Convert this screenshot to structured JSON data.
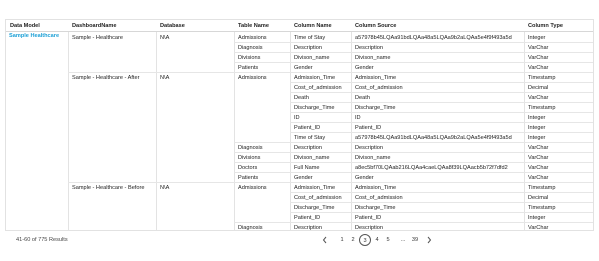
{
  "headers": [
    "Data Model",
    "DashboardName",
    "Database",
    "Table Name",
    "Column Name",
    "Column Source",
    "Column Type"
  ],
  "data_model": "Sample Healthcare",
  "groups": [
    {
      "dashboard": "Sample - Healthcare",
      "database": "N\\A",
      "tables": [
        {
          "name": "Admissions",
          "columns": [
            [
              "Time of Stay",
              "a57978b45LQAa91bdLQAa48a5LQAa9b2aLQAa5e4f9f493a5d",
              "Integer"
            ]
          ]
        },
        {
          "name": "Diagnosis",
          "columns": [
            [
              "Description",
              "Description",
              "VarChar"
            ]
          ]
        },
        {
          "name": "Divisions",
          "columns": [
            [
              "Divison_name",
              "Divison_name",
              "VarChar"
            ]
          ]
        },
        {
          "name": "Patients",
          "columns": [
            [
              "Gender",
              "Gender",
              "VarChar"
            ]
          ]
        }
      ]
    },
    {
      "dashboard": "Sample - Healthcare - After",
      "database": "N\\A",
      "tables": [
        {
          "name": "Admissions",
          "columns": [
            [
              "Admission_Time",
              "Admission_Time",
              "Timestamp"
            ],
            [
              "Cost_of_admission",
              "Cost_of_admission",
              "Decimal"
            ],
            [
              "Death",
              "Death",
              "VarChar"
            ],
            [
              "Discharge_Time",
              "Discharge_Time",
              "Timestamp"
            ],
            [
              "ID",
              "ID",
              "Integer"
            ],
            [
              "Patient_ID",
              "Patient_ID",
              "Integer"
            ],
            [
              "Time of Stay",
              "a57978b45LQAa91bdLQAa48a5LQAa9b2aLQAa5e4f9f493a5d",
              "Integer"
            ]
          ]
        },
        {
          "name": "Diagnosis",
          "columns": [
            [
              "Description",
              "Description",
              "VarChar"
            ]
          ]
        },
        {
          "name": "Divisions",
          "columns": [
            [
              "Divison_name",
              "Divison_name",
              "VarChar"
            ]
          ]
        },
        {
          "name": "Doctors",
          "columns": [
            [
              "Full Name",
              "a8ec5bf70LQAab216LQAa4caeLQAa8f39LQAacb5b72f7dfd2",
              "VarChar"
            ]
          ]
        },
        {
          "name": "Patients",
          "columns": [
            [
              "Gender",
              "Gender",
              "VarChar"
            ]
          ]
        }
      ]
    },
    {
      "dashboard": "Sample - Healthcare - Before",
      "database": "N\\A",
      "tables": [
        {
          "name": "Admissions",
          "columns": [
            [
              "Admission_Time",
              "Admission_Time",
              "Timestamp"
            ],
            [
              "Cost_of_admission",
              "Cost_of_admission",
              "Decimal"
            ],
            [
              "Discharge_Time",
              "Discharge_Time",
              "Timestamp"
            ],
            [
              "Patient_ID",
              "Patient_ID",
              "Integer"
            ]
          ]
        },
        {
          "name": "Diagnosis",
          "columns": [
            [
              "Description",
              "Description",
              "VarChar"
            ]
          ]
        }
      ]
    }
  ],
  "footer": {
    "results": "41-60 of 775 Results",
    "prev_icon": "chevron-left-icon",
    "next_icon": "chevron-right-icon",
    "pages": [
      "1",
      "2",
      "3",
      "4",
      "5",
      "...",
      "39"
    ],
    "current_page": "3"
  },
  "colors": {
    "accent": "#1da0d6",
    "grid": "#e6e6e6",
    "border": "#d7d7d7"
  }
}
